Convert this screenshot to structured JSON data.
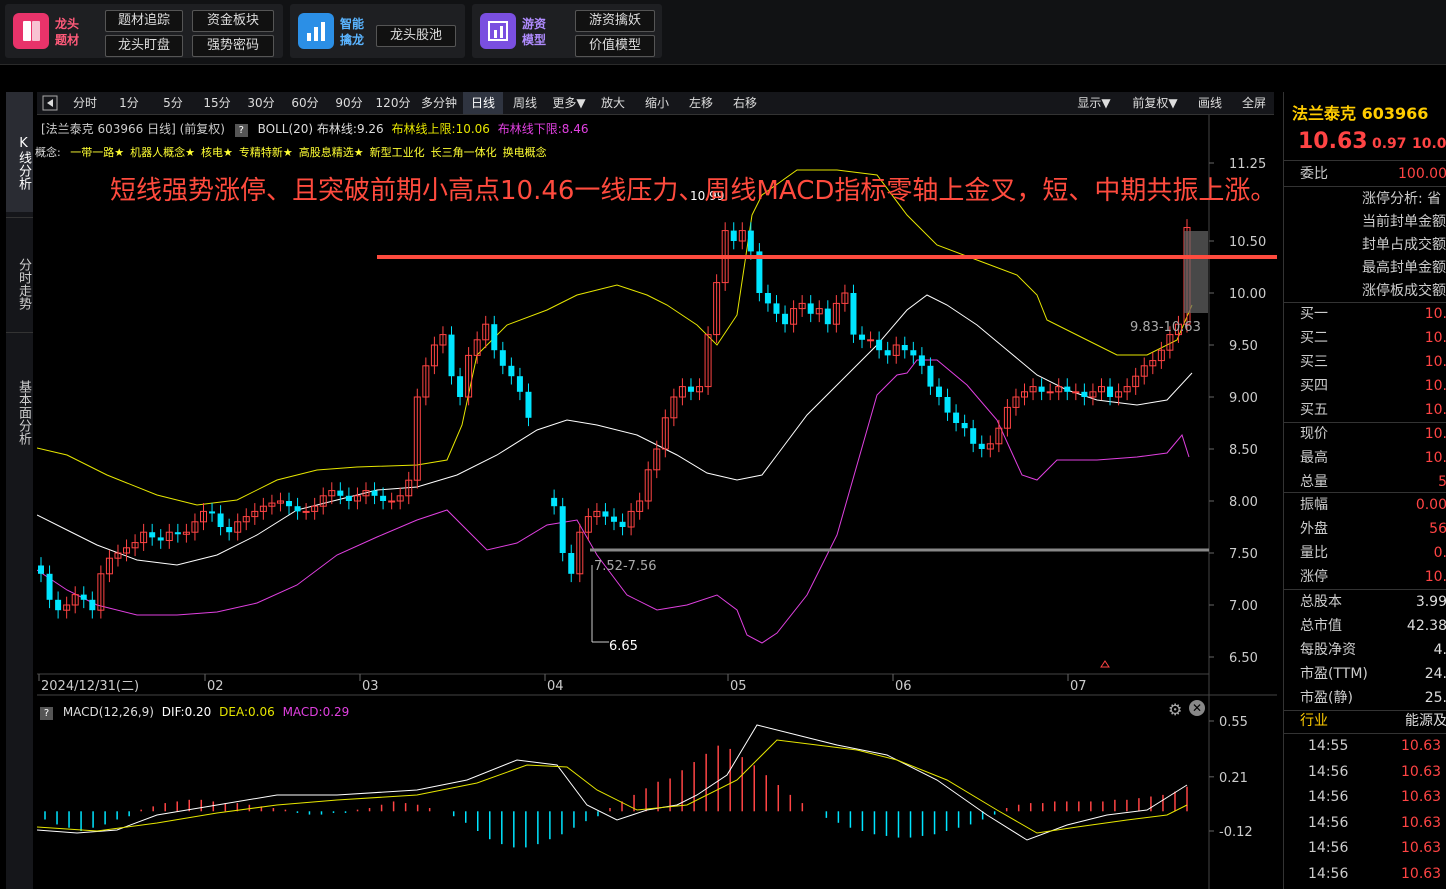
{
  "topbar": {
    "group1": {
      "title": "龙头题材",
      "btn1": "题材追踪",
      "btn2": "资金板块",
      "btn3": "龙头盯盘",
      "btn4": "强势密码"
    },
    "group2": {
      "title": "智能擒龙",
      "btn1": "龙头股池"
    },
    "group3": {
      "title": "游资模型",
      "btn1": "游资擒妖",
      "btn2": "价值模型"
    }
  },
  "leftnav": [
    "K线分析",
    "分时走势",
    "基本面分析"
  ],
  "toolbar": {
    "periods": [
      "分时",
      "1分",
      "5分",
      "15分",
      "30分",
      "60分",
      "90分",
      "120分",
      "多分钟",
      "日线",
      "周线",
      "更多▼",
      "放大",
      "缩小",
      "左移",
      "右移"
    ],
    "right": [
      "显示▼",
      "前复权▼",
      "画线",
      "全屏"
    ]
  },
  "chart": {
    "header": "[法兰泰克 603966 日线] (前复权)",
    "help": "?",
    "boll": "BOLL(20) 布林线:9.26",
    "boll_up": "布林线上限:10.06",
    "boll_dn": "布林线下限:8.46",
    "concept_label": "概念:",
    "concepts": [
      "一带一路★",
      "机器人概念★",
      "核电★",
      "专精特新★",
      "高股息精选★",
      "新型工业化",
      "长三角一体化",
      "换电概念"
    ],
    "annotation": "短线强势涨停、且突破前期小高点10.46一线压力、周线MACD指标零轴上金叉，短、中期共振上涨。",
    "yticks": [
      "11.25",
      "10.50",
      "10.00",
      "9.50",
      "9.00",
      "8.50",
      "8.00",
      "7.50",
      "7.00",
      "6.50"
    ],
    "xticks": [
      "2024/12/31(二)",
      "02",
      "03",
      "04",
      "05",
      "06",
      "07"
    ],
    "labels": {
      "high": "10.99",
      "range1": "7.52-7.56",
      "low": "6.65",
      "range2": "9.83-10.63"
    },
    "macd": {
      "title": "MACD(12,26,9)",
      "dif": "DIF:0.20",
      "dea": "DEA:0.06",
      "macd": "MACD:0.29",
      "yticks": [
        "0.55",
        "0.21",
        "-0.12"
      ]
    }
  },
  "quote": {
    "name": "法兰泰克 603966",
    "price": "10.63",
    "change": "0.97",
    "pct": "10.0",
    "weibi_label": "委比",
    "weibi_val": "100.00",
    "zt_lines": [
      "涨停分析: 省",
      "当前封单金额",
      "封单占成交额",
      "最高封单金额",
      "涨停板成交额"
    ],
    "buys": [
      {
        "l": "买一",
        "v": "10."
      },
      {
        "l": "买二",
        "v": "10."
      },
      {
        "l": "买三",
        "v": "10."
      },
      {
        "l": "买四",
        "v": "10."
      },
      {
        "l": "买五",
        "v": "10."
      }
    ],
    "stats1": [
      {
        "l": "现价",
        "v": "10."
      },
      {
        "l": "最高",
        "v": "10."
      },
      {
        "l": "总量",
        "v": "5"
      }
    ],
    "stats2": [
      {
        "l": "振幅",
        "v": "0.00"
      },
      {
        "l": "外盘",
        "v": "56"
      },
      {
        "l": "量比",
        "v": "0."
      },
      {
        "l": "涨停",
        "v": "10."
      }
    ],
    "stats3": [
      {
        "l": "总股本",
        "v": "3.99"
      },
      {
        "l": "总市值",
        "v": "42.38"
      },
      {
        "l": "每股净资",
        "v": "4."
      },
      {
        "l": "市盈(TTM)",
        "v": "24."
      },
      {
        "l": "市盈(静)",
        "v": "25."
      }
    ],
    "industry_label": "行业",
    "industry_val": "能源及",
    "ticks": [
      {
        "t": "14:55",
        "p": "10.63"
      },
      {
        "t": "14:56",
        "p": "10.63"
      },
      {
        "t": "14:56",
        "p": "10.63"
      },
      {
        "t": "14:56",
        "p": "10.63"
      },
      {
        "t": "14:56",
        "p": "10.63"
      },
      {
        "t": "14:56",
        "p": "10.63"
      }
    ]
  },
  "colors": {
    "up": "#ff4444",
    "down": "#00e5ff",
    "mid": "#ffffff",
    "upper": "#e6e600",
    "lower": "#e040e0",
    "annot": "#ff4b3e"
  }
}
